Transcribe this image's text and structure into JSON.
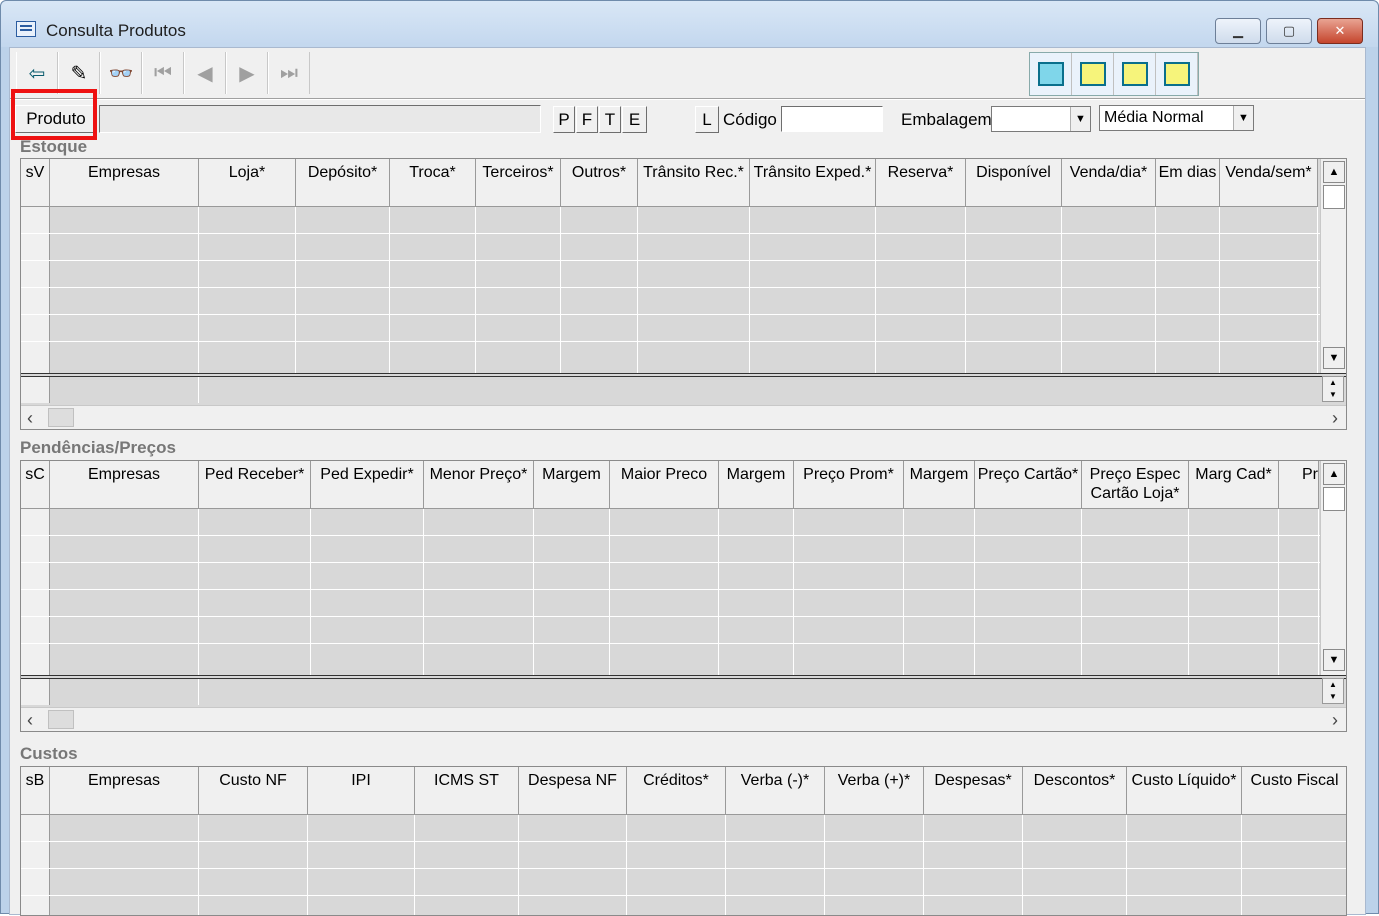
{
  "window": {
    "title": "Consulta Produtos"
  },
  "toolbar": {
    "buttons": [
      "exit-icon",
      "eraser-icon",
      "binoculars-icon",
      "first-icon",
      "prev-icon",
      "next-icon",
      "last-icon"
    ],
    "view_buttons": [
      "grid-view-icon",
      "view-1-icon",
      "view-2-icon",
      "view-3-icon"
    ]
  },
  "filter": {
    "produto_label": "Produto",
    "produto_value": "",
    "flags": [
      "P",
      "F",
      "T",
      "E"
    ],
    "l_label": "L",
    "codigo_label": "Código",
    "codigo_value": "",
    "embalagem_label": "Embalagem",
    "embalagem_value": "",
    "media_value": "Média Normal"
  },
  "estoque": {
    "title": "Estoque",
    "columns": [
      "sV",
      "Empresas",
      "Loja*",
      "Depósito*",
      "Troca*",
      "Terceiros*",
      "Outros*",
      "Trânsito Rec.*",
      "Trânsito Exped.*",
      "Reserva*",
      "Disponível",
      "Venda/dia*",
      "Em dias",
      "Venda/sem*"
    ]
  },
  "pendencias": {
    "title": "Pendências/Preços",
    "columns": [
      "sC",
      "Empresas",
      "Ped Receber*",
      "Ped Expedir*",
      "Menor Preço*",
      "Margem",
      "Maior Preco",
      "Margem",
      "Preço Prom*",
      "Margem",
      "Preço Cartão*",
      "Preço Espec Cartão Loja*",
      "Marg Cad*",
      "Pr"
    ]
  },
  "custos": {
    "title": "Custos",
    "columns": [
      "sB",
      "Empresas",
      "Custo NF",
      "IPI",
      "ICMS ST",
      "Despesa NF",
      "Créditos*",
      "Verba (-)*",
      "Verba (+)*",
      "Despesas*",
      "Descontos*",
      "Custo Líquido*",
      "Custo Fiscal"
    ]
  }
}
